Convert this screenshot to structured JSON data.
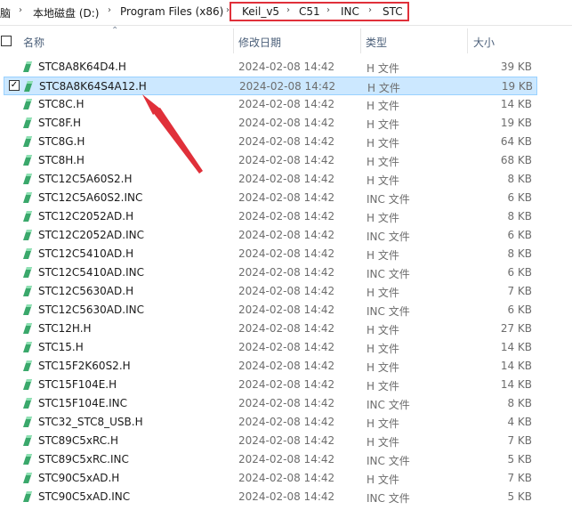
{
  "breadcrumb": {
    "items": [
      "脑",
      "本地磁盘 (D:)",
      "Program Files (x86)",
      "Keil_v5",
      "C51",
      "INC",
      "STC"
    ],
    "separator": "›"
  },
  "header": {
    "name": "名称",
    "date": "修改日期",
    "type": "类型",
    "size": "大小"
  },
  "colors": {
    "highlight_border": "#e0303a",
    "selection_bg": "#cce8ff",
    "arrow": "#e0303a"
  },
  "selected_row": 1,
  "files": [
    {
      "name": "STC8A8K64D4.H",
      "date": "2024-02-08 14:42",
      "type": "H 文件",
      "size": "39 KB"
    },
    {
      "name": "STC8A8K64S4A12.H",
      "date": "2024-02-08 14:42",
      "type": "H 文件",
      "size": "19 KB"
    },
    {
      "name": "STC8C.H",
      "date": "2024-02-08 14:42",
      "type": "H 文件",
      "size": "14 KB"
    },
    {
      "name": "STC8F.H",
      "date": "2024-02-08 14:42",
      "type": "H 文件",
      "size": "19 KB"
    },
    {
      "name": "STC8G.H",
      "date": "2024-02-08 14:42",
      "type": "H 文件",
      "size": "64 KB"
    },
    {
      "name": "STC8H.H",
      "date": "2024-02-08 14:42",
      "type": "H 文件",
      "size": "68 KB"
    },
    {
      "name": "STC12C5A60S2.H",
      "date": "2024-02-08 14:42",
      "type": "H 文件",
      "size": "8 KB"
    },
    {
      "name": "STC12C5A60S2.INC",
      "date": "2024-02-08 14:42",
      "type": "INC 文件",
      "size": "6 KB"
    },
    {
      "name": "STC12C2052AD.H",
      "date": "2024-02-08 14:42",
      "type": "H 文件",
      "size": "8 KB"
    },
    {
      "name": "STC12C2052AD.INC",
      "date": "2024-02-08 14:42",
      "type": "INC 文件",
      "size": "6 KB"
    },
    {
      "name": "STC12C5410AD.H",
      "date": "2024-02-08 14:42",
      "type": "H 文件",
      "size": "8 KB"
    },
    {
      "name": "STC12C5410AD.INC",
      "date": "2024-02-08 14:42",
      "type": "INC 文件",
      "size": "6 KB"
    },
    {
      "name": "STC12C5630AD.H",
      "date": "2024-02-08 14:42",
      "type": "H 文件",
      "size": "7 KB"
    },
    {
      "name": "STC12C5630AD.INC",
      "date": "2024-02-08 14:42",
      "type": "INC 文件",
      "size": "6 KB"
    },
    {
      "name": "STC12H.H",
      "date": "2024-02-08 14:42",
      "type": "H 文件",
      "size": "27 KB"
    },
    {
      "name": "STC15.H",
      "date": "2024-02-08 14:42",
      "type": "H 文件",
      "size": "14 KB"
    },
    {
      "name": "STC15F2K60S2.H",
      "date": "2024-02-08 14:42",
      "type": "H 文件",
      "size": "14 KB"
    },
    {
      "name": "STC15F104E.H",
      "date": "2024-02-08 14:42",
      "type": "H 文件",
      "size": "14 KB"
    },
    {
      "name": "STC15F104E.INC",
      "date": "2024-02-08 14:42",
      "type": "INC 文件",
      "size": "8 KB"
    },
    {
      "name": "STC32_STC8_USB.H",
      "date": "2024-02-08 14:42",
      "type": "H 文件",
      "size": "4 KB"
    },
    {
      "name": "STC89C5xRC.H",
      "date": "2024-02-08 14:42",
      "type": "H 文件",
      "size": "7 KB"
    },
    {
      "name": "STC89C5xRC.INC",
      "date": "2024-02-08 14:42",
      "type": "INC 文件",
      "size": "5 KB"
    },
    {
      "name": "STC90C5xAD.H",
      "date": "2024-02-08 14:42",
      "type": "H 文件",
      "size": "7 KB"
    },
    {
      "name": "STC90C5xAD.INC",
      "date": "2024-02-08 14:42",
      "type": "INC 文件",
      "size": "5 KB"
    }
  ]
}
